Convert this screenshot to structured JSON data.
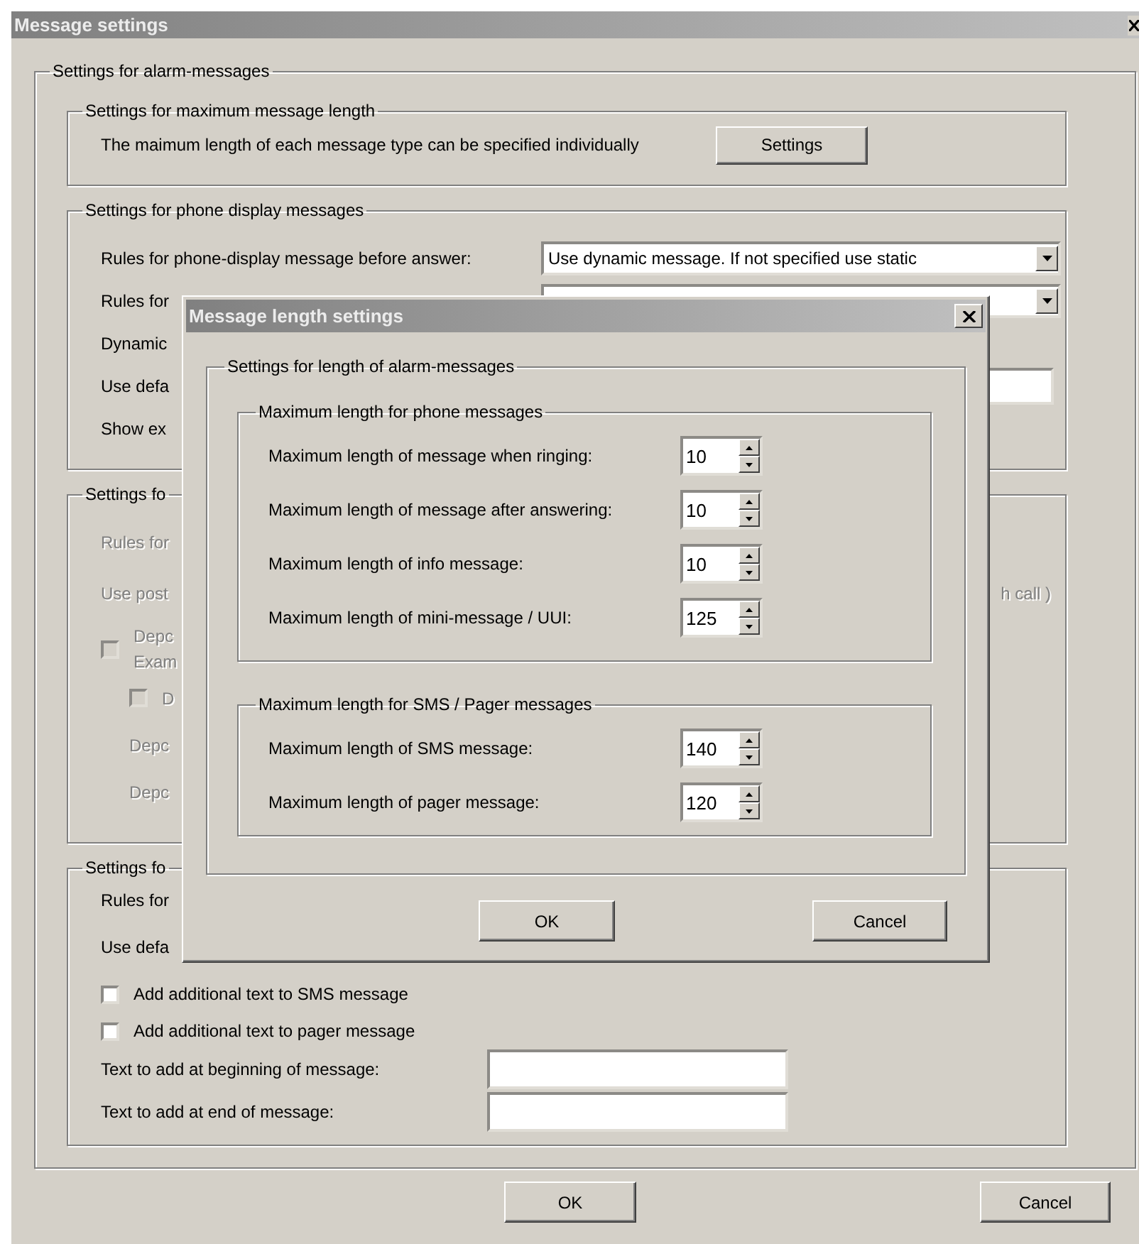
{
  "window": {
    "title": "Message settings"
  },
  "alarm_group": {
    "title": "Settings for alarm-messages",
    "length_group": {
      "title": "Settings for maximum message length",
      "text": "The maimum length of each message type can be specified individually",
      "button": "Settings"
    },
    "groups": [
      {
        "title": "Settings for phone display messages",
        "disabled": false,
        "rows": [
          {
            "kind": "dropdown",
            "label": "Rules for phone-display message before answer:",
            "value": "Use dynamic message. If not specified use static"
          },
          {
            "kind": "dropdown",
            "label": "Rules for"
          },
          {
            "kind": "label",
            "label": "Dynamic"
          },
          {
            "kind": "field",
            "label": "Use defa"
          },
          {
            "kind": "label",
            "label": "Show ex"
          }
        ]
      },
      {
        "title": "Settings fo",
        "disabled": true,
        "rows": [
          {
            "kind": "label",
            "label": "Rules for"
          },
          {
            "kind": "label",
            "label": "Use post",
            "trailing": "h call )"
          },
          {
            "kind": "checkbox",
            "lines": [
              "Depc",
              "Exam"
            ],
            "checked": false,
            "children": [
              {
                "kind": "checkbox",
                "lines": [
                  "D"
                ],
                "checked": false
              },
              {
                "kind": "label",
                "label": "Depc"
              },
              {
                "kind": "label",
                "label": "Depc"
              }
            ]
          }
        ]
      },
      {
        "title": "Settings fo",
        "disabled": false,
        "rows": [
          {
            "kind": "label",
            "label": "Rules for"
          },
          {
            "kind": "label",
            "label": "Use defa"
          },
          {
            "kind": "checkbox",
            "lines": [
              "Add additional text to SMS message"
            ],
            "checked": false
          },
          {
            "kind": "checkbox",
            "lines": [
              "Add additional text to pager message"
            ],
            "checked": false
          },
          {
            "kind": "field",
            "label": "Text to add at beginning of message:"
          },
          {
            "kind": "field",
            "label": "Text to add at end of message:"
          }
        ]
      }
    ]
  },
  "buttons": [
    "OK",
    "Cancel"
  ],
  "dialog": {
    "title": "Message length settings",
    "group_title": "Settings for length of alarm-messages",
    "subgroups": [
      {
        "title": "Maximum length for phone messages",
        "rows": [
          {
            "label": "Maximum length of message when ringing:",
            "value": "10"
          },
          {
            "label": "Maximum length of message after answering:",
            "value": "10"
          },
          {
            "label": "Maximum length of info message:",
            "value": "10"
          },
          {
            "label": "Maximum length of mini-message / UUI:",
            "value": "125"
          }
        ]
      },
      {
        "title": "Maximum length for SMS / Pager messages",
        "rows": [
          {
            "label": "Maximum length of SMS message:",
            "value": "140"
          },
          {
            "label": "Maximum length of pager message:",
            "value": "120"
          }
        ]
      }
    ],
    "buttons": [
      "OK",
      "Cancel"
    ]
  }
}
